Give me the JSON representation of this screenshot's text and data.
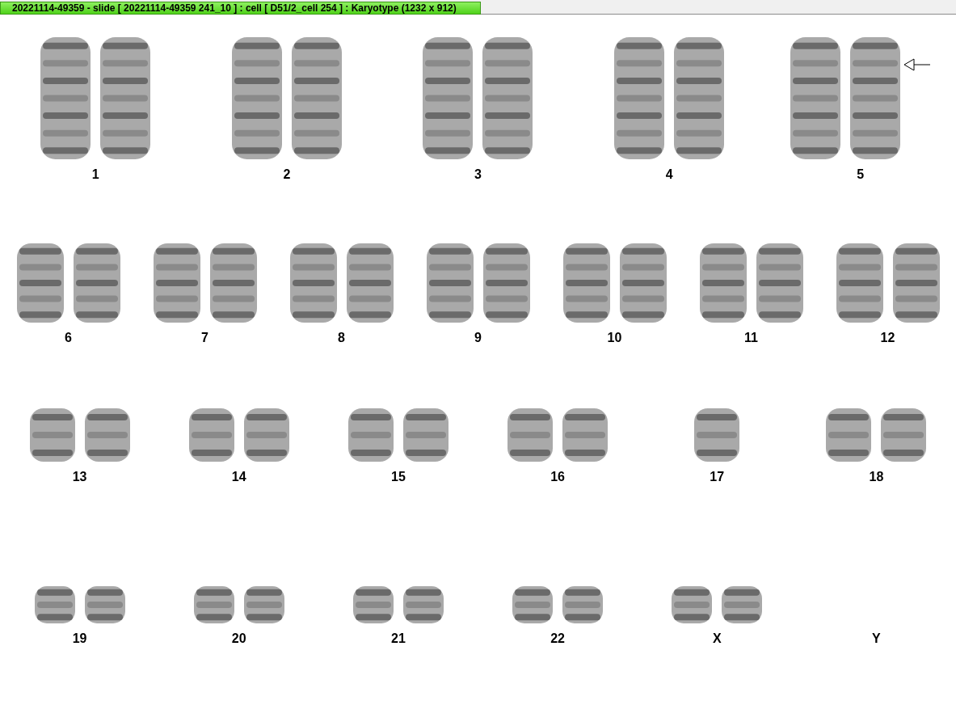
{
  "window": {
    "title": "20221114-49359 - slide [ 20221114-49359 241_10 ] : cell [ D51/2_cell 254 ] : Karyotype  (1232 x 912)"
  },
  "karyotype_rows": [
    {
      "items": [
        {
          "label": "1",
          "kind": "pair",
          "marked": false
        },
        {
          "label": "2",
          "kind": "pair",
          "marked": false
        },
        {
          "label": "3",
          "kind": "pair",
          "marked": false
        },
        {
          "label": "4",
          "kind": "pair",
          "marked": false
        },
        {
          "label": "5",
          "kind": "pair",
          "marked": true
        }
      ]
    },
    {
      "items": [
        {
          "label": "6",
          "kind": "pair",
          "marked": false
        },
        {
          "label": "7",
          "kind": "pair",
          "marked": false
        },
        {
          "label": "8",
          "kind": "pair",
          "marked": false
        },
        {
          "label": "9",
          "kind": "pair",
          "marked": false
        },
        {
          "label": "10",
          "kind": "pair",
          "marked": false
        },
        {
          "label": "11",
          "kind": "pair",
          "marked": false
        },
        {
          "label": "12",
          "kind": "pair",
          "marked": false
        }
      ]
    },
    {
      "items": [
        {
          "label": "13",
          "kind": "pair",
          "marked": false
        },
        {
          "label": "14",
          "kind": "pair",
          "marked": false
        },
        {
          "label": "15",
          "kind": "pair",
          "marked": false
        },
        {
          "label": "16",
          "kind": "pair",
          "marked": false
        },
        {
          "label": "17",
          "kind": "single",
          "marked": false
        },
        {
          "label": "18",
          "kind": "pair",
          "marked": false
        }
      ]
    },
    {
      "items": [
        {
          "label": "19",
          "kind": "pair",
          "marked": false
        },
        {
          "label": "20",
          "kind": "pair",
          "marked": false
        },
        {
          "label": "21",
          "kind": "pair",
          "marked": false
        },
        {
          "label": "22",
          "kind": "pair",
          "marked": false
        },
        {
          "label": "X",
          "kind": "pair",
          "marked": false
        },
        {
          "label": "Y",
          "kind": "none",
          "marked": false
        }
      ]
    }
  ]
}
